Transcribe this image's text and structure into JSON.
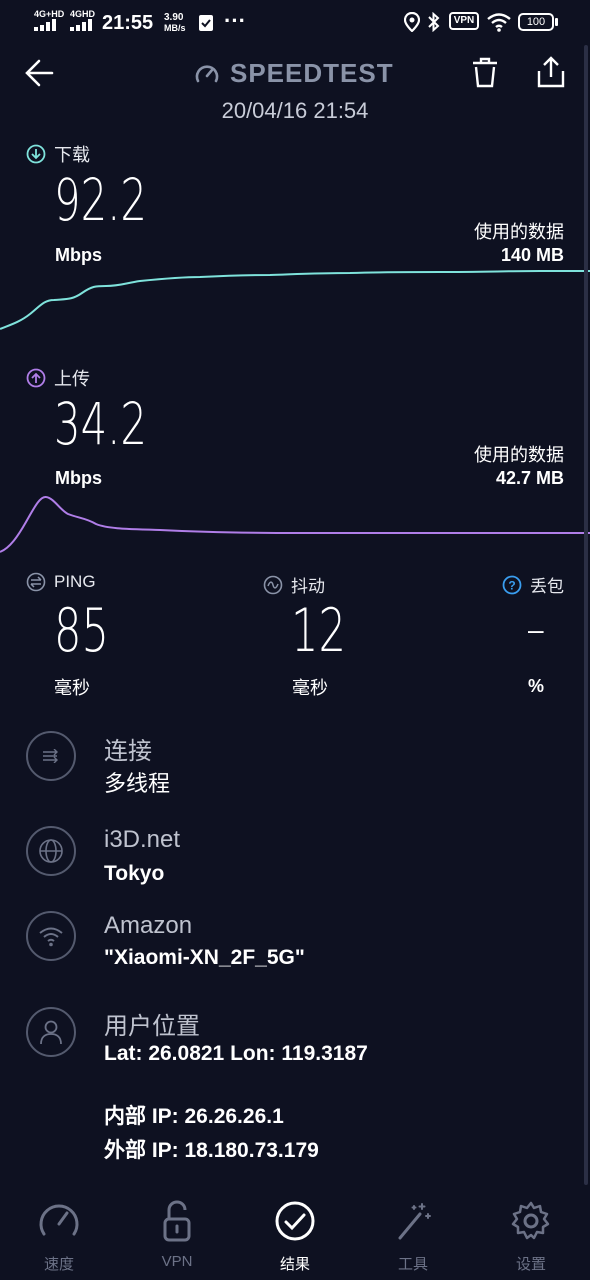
{
  "status_bar": {
    "signal1_tag": "4G+HD",
    "signal2_tag": "4GHD",
    "time": "21:55",
    "speed_value": "3.90",
    "speed_unit": "MB/s",
    "more": "···",
    "vpn_badge": "VPN",
    "battery": "100"
  },
  "header": {
    "title": "SPEEDTEST",
    "date": "20/04/16 21:54"
  },
  "download": {
    "label": "下载",
    "value": "92.2",
    "unit": "Mbps",
    "data_used_label": "使用的数据",
    "data_used_value": "140 MB",
    "color": "#7fe3dc"
  },
  "upload": {
    "label": "上传",
    "value": "34.2",
    "unit": "Mbps",
    "data_used_label": "使用的数据",
    "data_used_value": "42.7 MB",
    "color": "#b07ee8"
  },
  "metrics": {
    "ping": {
      "label": "PING",
      "value": "85",
      "unit": "毫秒"
    },
    "jitter": {
      "label": "抖动",
      "value": "12",
      "unit": "毫秒"
    },
    "loss": {
      "label": "丢包",
      "value": "–",
      "unit": "%"
    }
  },
  "info": {
    "connection": {
      "title": "连接",
      "value": "多线程"
    },
    "server": {
      "title": "i3D.net",
      "value": "Tokyo"
    },
    "provider": {
      "title": "Amazon",
      "value": "\"Xiaomi-XN_2F_5G\""
    },
    "location": {
      "title": "用户位置",
      "value": "Lat: 26.0821 Lon: 119.3187"
    },
    "internal_ip": "内部 IP: 26.26.26.1",
    "external_ip": "外部 IP: 18.180.73.179"
  },
  "nav": {
    "speed": "速度",
    "vpn": "VPN",
    "results": "结果",
    "tools": "工具",
    "settings": "设置"
  },
  "icons": {
    "back": "back-arrow-icon",
    "delete": "trash-icon",
    "share": "share-icon"
  }
}
